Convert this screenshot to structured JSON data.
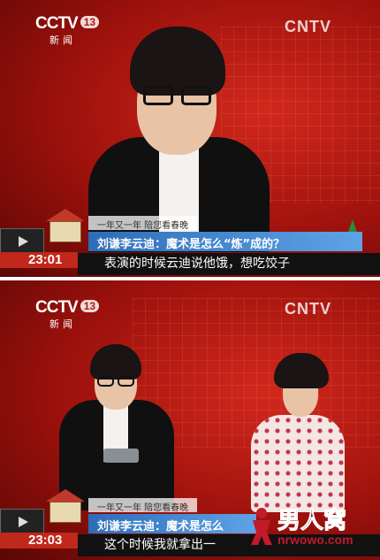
{
  "channel": {
    "name": "CCTV",
    "number": "13",
    "sub": "新闻",
    "portal": "CNTV"
  },
  "frames": [
    {
      "ticker_top": "一年又一年 陪您看春晚",
      "ticker_title": "刘谦李云迪：魔术是怎么“炼”成的？",
      "time": "23:01",
      "subtitle": "表演的时候云迪说他饿，想吃饺子"
    },
    {
      "ticker_top": "一年又一年 陪您看春晚",
      "ticker_title": "刘谦李云迪：魔术是怎么",
      "time": "23:03",
      "subtitle": "这个时候我就拿出一"
    }
  ],
  "watermark": {
    "text": "男人窝",
    "url": "nrwowo.com"
  },
  "colors": {
    "background_red": "#b0180f",
    "title_blue": "#3d82cf",
    "time_red": "#c1281c",
    "watermark_red": "#c31a2a"
  }
}
